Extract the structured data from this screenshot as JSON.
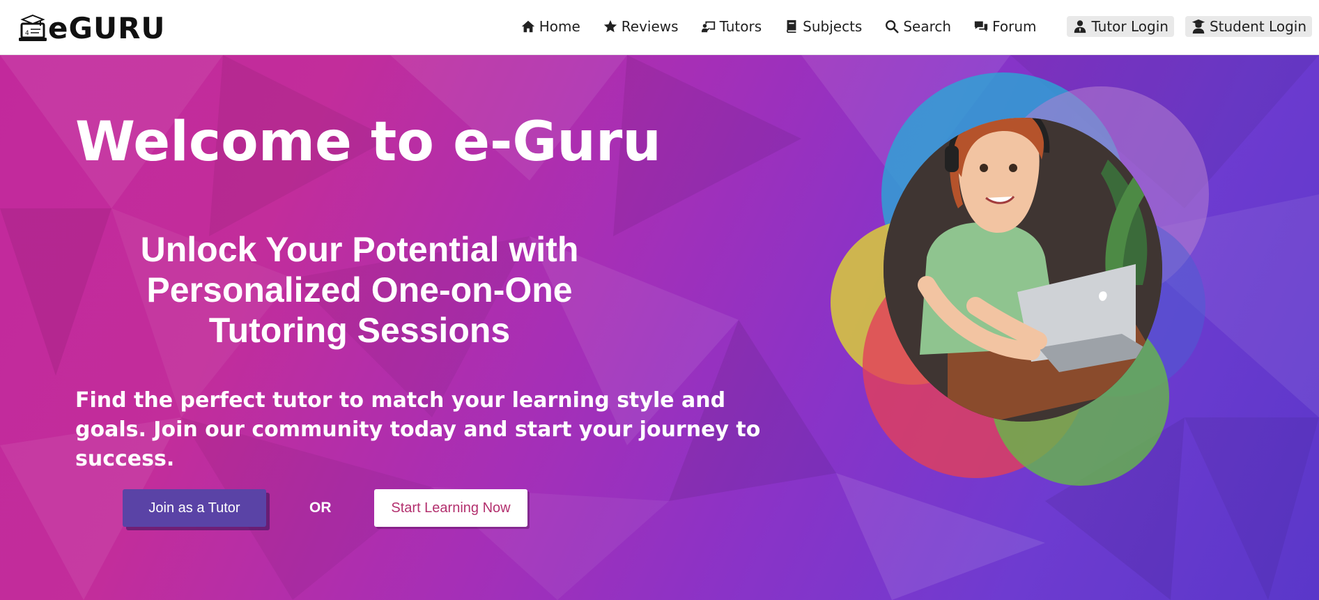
{
  "brand": {
    "name": "eGURU",
    "logo_icon": "laptop-graduation-cap-icon"
  },
  "nav": {
    "items": [
      {
        "label": "Home",
        "icon": "home-icon"
      },
      {
        "label": "Reviews",
        "icon": "star-icon"
      },
      {
        "label": "Tutors",
        "icon": "chalkboard-teacher-icon"
      },
      {
        "label": "Subjects",
        "icon": "book-icon"
      },
      {
        "label": "Search",
        "icon": "search-icon"
      },
      {
        "label": "Forum",
        "icon": "comments-icon"
      }
    ],
    "tutor_login": "Tutor Login",
    "student_login": "Student Login"
  },
  "hero": {
    "title": "Welcome to e-Guru",
    "subtitle_lines": [
      "Unlock Your Potential with",
      "Personalized One-on-One",
      "Tutoring Sessions"
    ],
    "description": "Find the perfect tutor to match your learning style and goals. Join our community today and start your journey to success.",
    "join_button": "Join as a Tutor",
    "or_label": "OR",
    "learn_button": "Start Learning Now",
    "illustration": "student-with-headphones-and-laptop-illustration"
  },
  "colors": {
    "hero_pink": "#c2299c",
    "hero_purple": "#5a37c9",
    "join_button_bg": "#5a43a6",
    "learn_button_text": "#b3306e",
    "circle_blue": "#2aa6d4",
    "circle_yellow": "#d9cc3a",
    "circle_red": "#e2405a",
    "circle_green": "#67b84a",
    "circle_mauve": "#b47fcf"
  }
}
